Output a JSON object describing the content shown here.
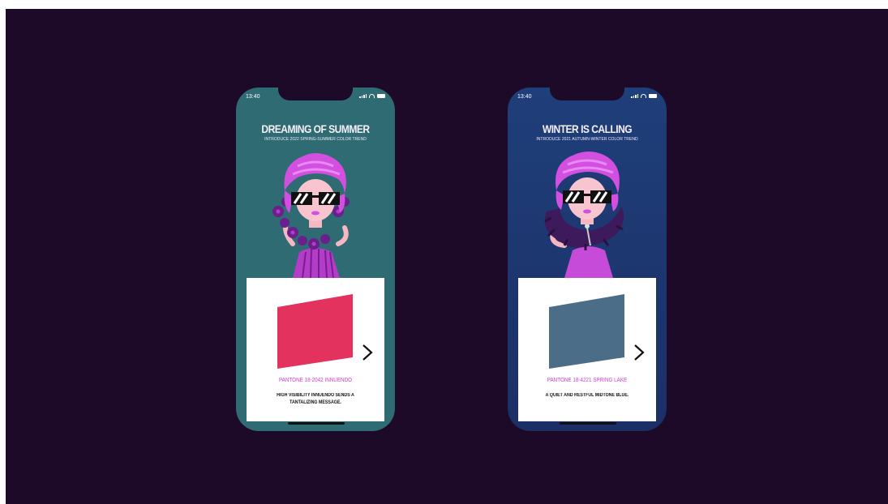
{
  "phones": [
    {
      "status_time": "13:40",
      "title": "DREAMING OF SUMMER",
      "subtitle": "INTRODUCE 2022 SPRING-SUMMER COLOR TREND",
      "pantone_label": "PANTONE 18-2042 INNUENDO",
      "description": "HIGH VISIBILITY INNUENDO SENDS A TANTALIZING MESSAGE.",
      "background_color": "#2f6b73",
      "swatch_color": "#e4325f"
    },
    {
      "status_time": "13:40",
      "title": "WINTER IS CALLING",
      "subtitle": "INTRODUCE 2021 AUTUMN-WINTER COLOR TREND",
      "pantone_label": "PANTONE 18-4221 SPRING LAKE",
      "description": "A QUIET AND RESTFUL MIDTONE BLUE.",
      "background_color": "#1f3f7a",
      "swatch_color": "#4b6d88"
    }
  ],
  "icons": {
    "next": "chevron-right-icon",
    "signal": "signal-icon",
    "wifi": "wifi-icon",
    "battery": "battery-icon"
  },
  "colors": {
    "stage_background": "#1c0a28",
    "pantone_text": "#cf3fd2",
    "hair": "#d24fe0"
  }
}
